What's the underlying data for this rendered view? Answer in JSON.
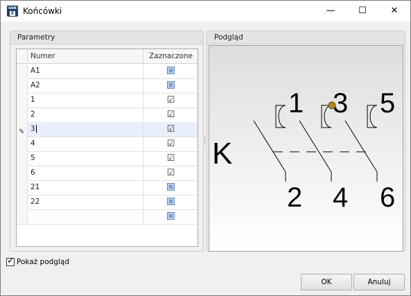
{
  "window": {
    "title": "Końcówki",
    "app_icon_top": "see",
    "app_icon_bottom": "E",
    "min_glyph": "—",
    "max_glyph": "☐",
    "close_glyph": "✕"
  },
  "parametry": {
    "title": "Parametry",
    "columns": {
      "numer": "Numer",
      "zaznaczone": "Zaznaczone"
    },
    "rows": [
      {
        "numer": "A1",
        "checked": false
      },
      {
        "numer": "A2",
        "checked": false
      },
      {
        "numer": "1",
        "checked": true
      },
      {
        "numer": "2",
        "checked": true
      },
      {
        "numer": "3",
        "checked": true,
        "editing": true
      },
      {
        "numer": "4",
        "checked": true
      },
      {
        "numer": "5",
        "checked": true
      },
      {
        "numer": "6",
        "checked": true
      },
      {
        "numer": "21",
        "checked": false
      },
      {
        "numer": "22",
        "checked": false
      },
      {
        "numer": "",
        "checked": false
      }
    ]
  },
  "podglad": {
    "title": "Podgląd",
    "symbol": {
      "label": "K",
      "top_numbers": [
        "1",
        "3",
        "5"
      ],
      "bottom_numbers": [
        "2",
        "4",
        "6"
      ]
    }
  },
  "show_preview": {
    "label": "Pokaż podgląd",
    "checked": true
  },
  "buttons": {
    "ok": "OK",
    "cancel": "Anuluj"
  },
  "icons": [
    "app-icon",
    "minimize-icon",
    "maximize-icon",
    "close-icon",
    "pencil-icon",
    "checkbox-icon"
  ]
}
